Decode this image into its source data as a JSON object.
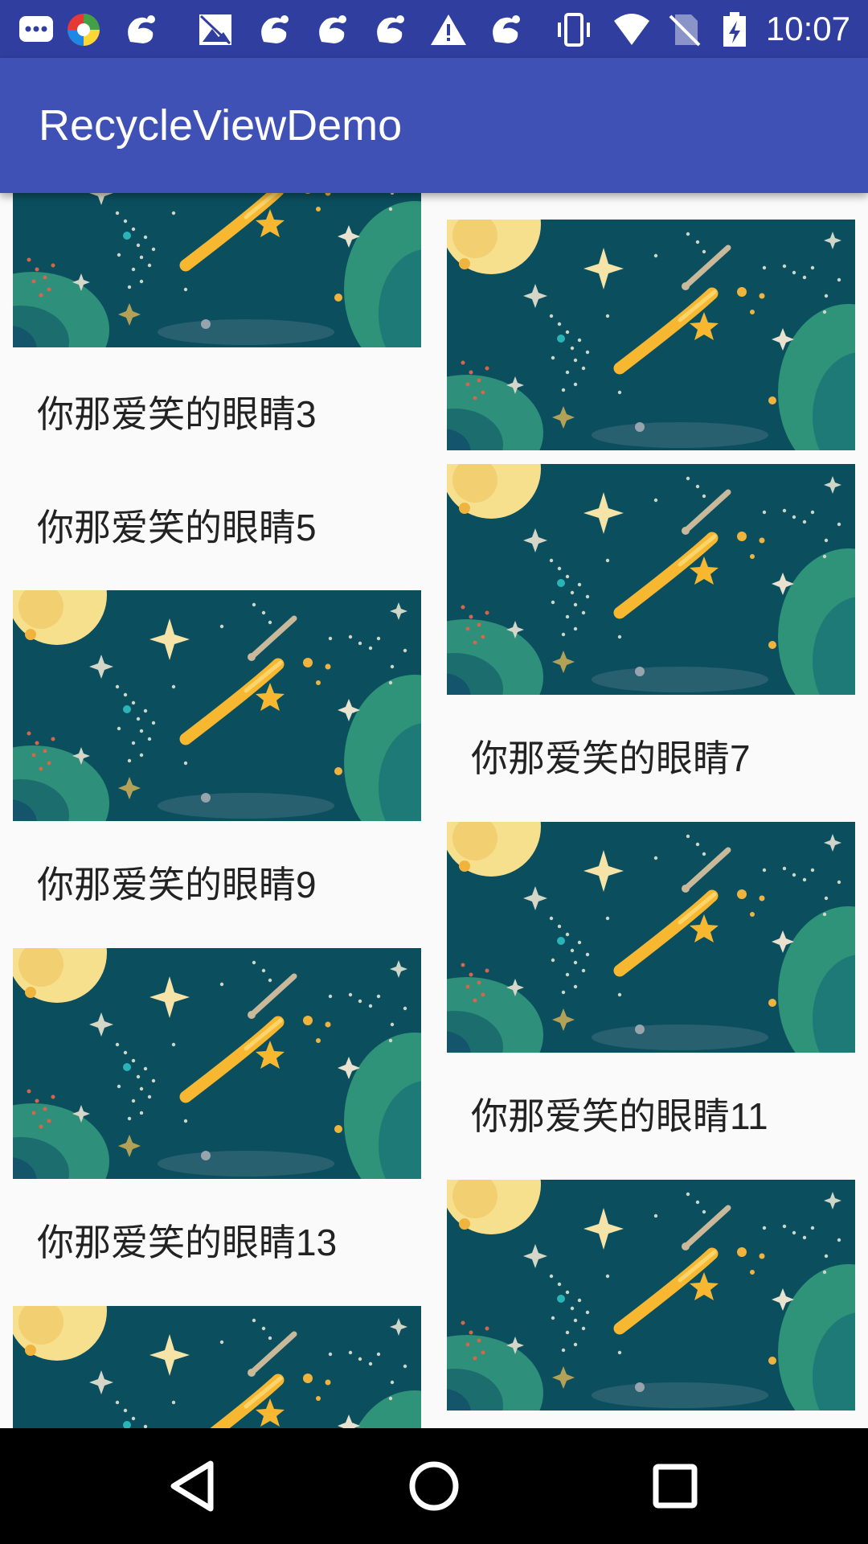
{
  "status_bar": {
    "time": "10:07",
    "icons": [
      "message-icon",
      "colorful-app-icon",
      "squirrel-icon",
      "image-icon",
      "squirrel-icon",
      "squirrel-icon",
      "squirrel-icon",
      "warning-icon",
      "squirrel-icon",
      "vibrate-icon",
      "wifi-icon",
      "no-sim-icon",
      "battery-charging-icon"
    ]
  },
  "app_bar": {
    "title": "RecycleViewDemo"
  },
  "list": {
    "captions": {
      "item3": "你那爱笑的眼睛3",
      "item5": "你那爱笑的眼睛5",
      "item7": "你那爱笑的眼睛7",
      "item9": "你那爱笑的眼睛9",
      "item11": "你那爱笑的眼睛11",
      "item13": "你那爱笑的眼睛13"
    }
  },
  "nav_bar": {
    "buttons": [
      "back-icon",
      "home-icon",
      "recents-icon"
    ]
  },
  "colors": {
    "status_bar": "#303f9f",
    "app_bar": "#3f51b5",
    "image_bg": "#0b4f5f",
    "meteor": "#f7b731"
  }
}
